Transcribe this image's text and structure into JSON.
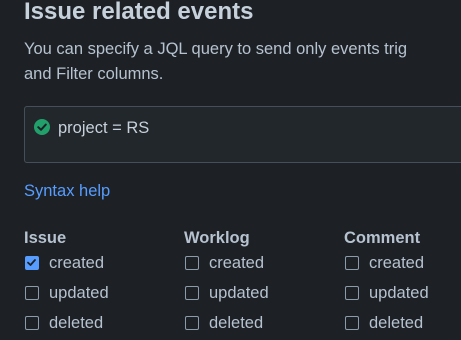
{
  "section": {
    "title": "Issue related events",
    "description_line1": "You can specify a JQL query to send only events trig",
    "description_line2": "and Filter columns."
  },
  "jql": {
    "query": "project = RS",
    "status": "valid",
    "status_icon": "check-circle-icon"
  },
  "help_link": "Syntax help",
  "columns": [
    {
      "title": "Issue",
      "options": [
        {
          "label": "created",
          "checked": true
        },
        {
          "label": "updated",
          "checked": false
        },
        {
          "label": "deleted",
          "checked": false
        }
      ]
    },
    {
      "title": "Worklog",
      "options": [
        {
          "label": "created",
          "checked": false
        },
        {
          "label": "updated",
          "checked": false
        },
        {
          "label": "deleted",
          "checked": false
        }
      ]
    },
    {
      "title": "Comment",
      "options": [
        {
          "label": "created",
          "checked": false
        },
        {
          "label": "updated",
          "checked": false
        },
        {
          "label": "deleted",
          "checked": false
        }
      ]
    }
  ],
  "colors": {
    "background": "#1d2125",
    "link": "#579dff",
    "checkbox_checked": "#579dff",
    "valid_icon": "#22a06b"
  }
}
